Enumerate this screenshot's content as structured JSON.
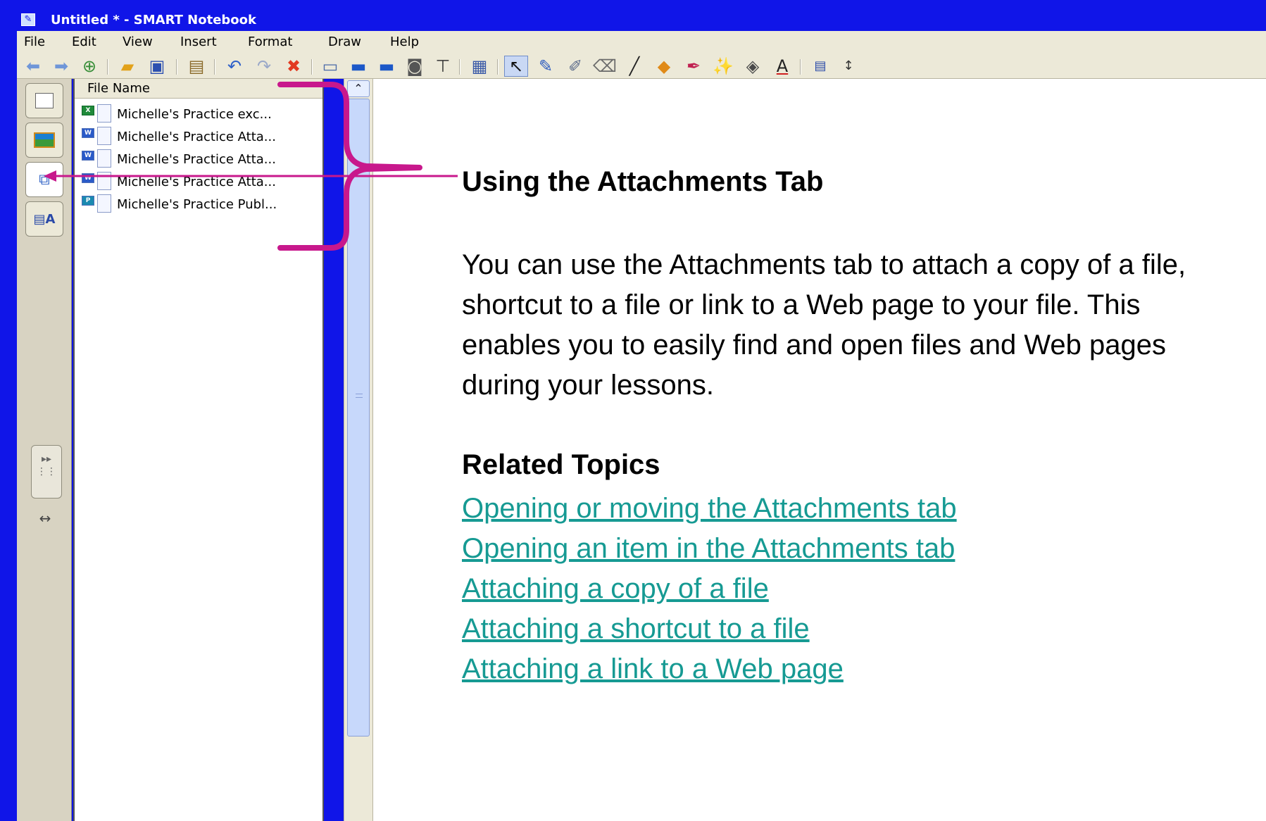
{
  "window": {
    "title": "Untitled * - SMART Notebook"
  },
  "menu": [
    "File",
    "Edit",
    "View",
    "Insert",
    "Format",
    "Draw",
    "Help"
  ],
  "toolbar": {
    "icons": [
      "back-arrow-icon",
      "forward-arrow-icon",
      "add-page-icon",
      "open-folder-icon",
      "save-icon",
      "paste-icon",
      "undo-icon",
      "redo-icon",
      "delete-icon",
      "screen-shade-icon",
      "full-screen-icon",
      "dual-page-icon",
      "capture-icon",
      "document-camera-icon",
      "table-icon",
      "select-icon",
      "pen-icon",
      "creative-pen-icon",
      "eraser-icon",
      "line-icon",
      "shapes-icon",
      "magic-pen-icon",
      "shape-recognition-pen-icon",
      "fill-icon",
      "text-icon",
      "properties-icon",
      "move-toolbar-icon"
    ]
  },
  "side_tabs": [
    "page-sorter-icon",
    "gallery-icon",
    "attachments-icon",
    "properties-icon"
  ],
  "file_panel": {
    "header": "File Name",
    "files": [
      {
        "name": "Michelle's Practice exc...",
        "type": "XL"
      },
      {
        "name": "Michelle's Practice Atta...",
        "type": "W"
      },
      {
        "name": "Michelle's Practice Atta...",
        "type": "W"
      },
      {
        "name": "Michelle's Practice Atta...",
        "type": "W"
      },
      {
        "name": "Michelle's Practice Publ...",
        "type": "P"
      }
    ]
  },
  "content": {
    "heading": "Using the Attachments Tab",
    "body": "You can use the Attachments tab to attach a copy of a file, shortcut to a file or link to a Web page to your file. This enables you to easily find and open files and Web pages during your lessons.",
    "related_heading": "Related Topics",
    "links": [
      "Opening or moving the Attachments tab",
      "Opening an item in the Attachments tab",
      "Attaching a copy of a file",
      "Attaching a shortcut to a file",
      "Attaching a link to a Web page"
    ]
  },
  "colors": {
    "frame": "#1015e8",
    "annotation": "#c8188c",
    "link": "#169a93",
    "chrome": "#ece9d8"
  }
}
